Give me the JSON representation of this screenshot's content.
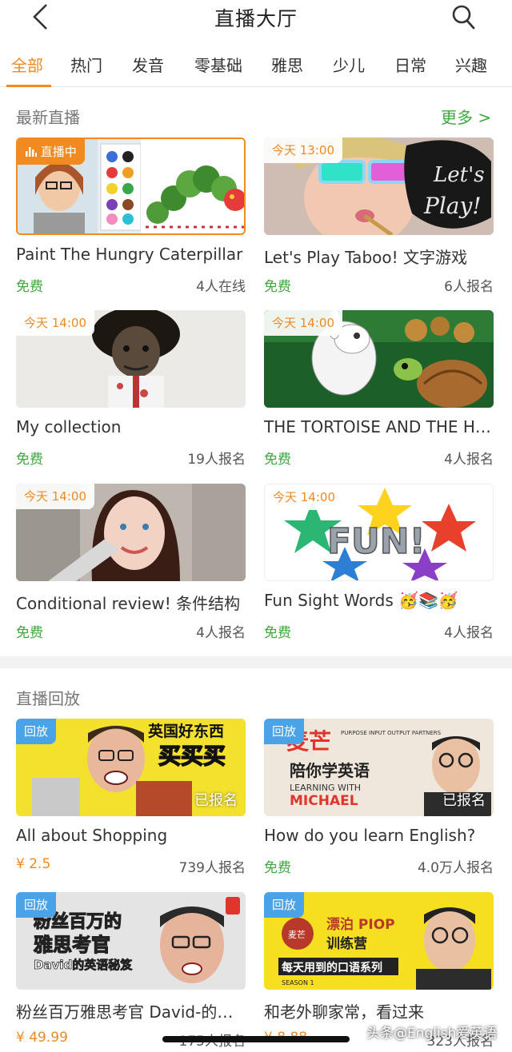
{
  "header": {
    "title": "直播大厅",
    "back_icon": "chevron-left-icon",
    "search_icon": "search-icon"
  },
  "tabs": [
    {
      "label": "全部",
      "active": true
    },
    {
      "label": "热门"
    },
    {
      "label": "发音"
    },
    {
      "label": "零基础"
    },
    {
      "label": "雅思"
    },
    {
      "label": "少儿"
    },
    {
      "label": "日常"
    },
    {
      "label": "兴趣"
    }
  ],
  "colors": {
    "accent": "#f08a24",
    "free_green": "#3fa83d",
    "replay_blue": "#4aa3e6"
  },
  "live_section": {
    "title": "最新直播",
    "more": "更多 >",
    "cards": [
      {
        "badge": "直播中",
        "title": "Paint The Hungry Caterpillar",
        "price": "免费",
        "count": "4人在线"
      },
      {
        "badge": "今天 13:00",
        "title": "Let's Play Taboo! 文字游戏",
        "price": "免费",
        "count": "6人报名"
      },
      {
        "badge": "今天 14:00",
        "title": "My collection",
        "price": "免费",
        "count": "19人报名"
      },
      {
        "badge": "今天 14:00",
        "title": "THE TORTOISE AND THE HARE",
        "price": "免费",
        "count": "4人报名"
      },
      {
        "badge": "今天 14:00",
        "title": "Conditional review! 条件结构",
        "price": "免费",
        "count": "4人报名"
      },
      {
        "badge": "今天 14:00",
        "title": "Fun Sight Words 🥳📚🥳",
        "price": "免费",
        "count": "4人报名"
      }
    ]
  },
  "replay_section": {
    "title": "直播回放",
    "cards": [
      {
        "badge": "回放",
        "overlay": "已报名",
        "title": "All about Shopping",
        "price": "¥ 2.5",
        "count": "739人报名"
      },
      {
        "badge": "回放",
        "overlay": "已报名",
        "title": "How do you learn English?",
        "price": "免费",
        "count": "4.0万人报名"
      },
      {
        "badge": "回放",
        "title": "粉丝百万雅思考官 David-的英语秘笈",
        "price": "¥ 49.99",
        "count": "175人报名"
      },
      {
        "badge": "回放",
        "title": "和老外聊家常，看过来",
        "price": "¥ 8.88",
        "count": "323人报名"
      }
    ]
  },
  "thumb_texts": {
    "lets_play": "Let's Play!",
    "fun": "FUN!",
    "shop_line1": "英国好东西",
    "shop_line2": "买买买",
    "mai_logo": "麦芒",
    "mai_sub": "PURPOSE INPUT OUTPUT PARTNERS",
    "mai_line": "陪你学英语",
    "mai_learning": "LEARNING WITH",
    "mai_name": "MICHAEL",
    "david_line1": "粉丝百万的",
    "david_line2": "雅思考官",
    "david_line3": "David的英语秘笈",
    "piop_brand": "麦芒",
    "piop_line1": "漂泊 PIOP",
    "piop_line2": "训练营",
    "piop_line3": "每天用到的口语系列",
    "piop_season": "SEASON 1"
  },
  "watermark": "头条@English爱英语"
}
